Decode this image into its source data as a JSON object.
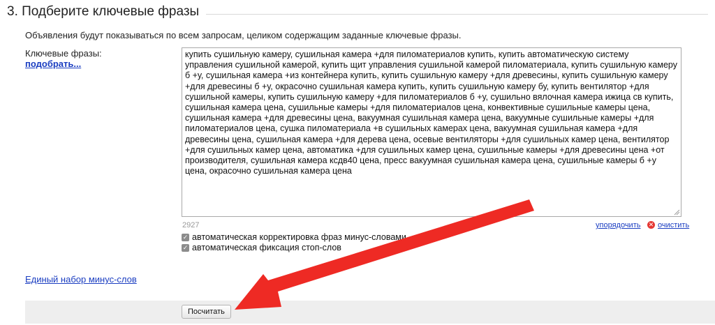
{
  "section": {
    "title": "3. Подберите ключевые фразы",
    "description": "Объявления будут показываться по всем запросам, целиком содержащим заданные ключевые фразы."
  },
  "keywords": {
    "label": "Ключевые фразы:",
    "pick_link": "подобрать...",
    "text": "купить сушильную камеру, сушильная камера +для пиломатериалов купить, купить автоматическую систему управления сушильной камерой, купить щит управления сушильной камерой пиломатериала, купить сушильную камеру б +у, сушильная камера +из контейнера купить, купить сушильную камеру +для древесины, купить сушильную камеру +для древесины б +у, окрасочно сушильная камера купить, купить сушильную камеру бу, купить вентилятор +для сушильной камеры, купить сушильную камеру +для пиломатериалов б +у, сушильно вялочная камера ижица св купить, сушильная камера цена, сушильные камеры +для пиломатериалов цена, конвективные сушильные камеры цена, сушильная камера +для древесины цена, вакуумная сушильная камера цена, вакуумные сушильные камеры +для пиломатериалов цена, сушка пиломатериала +в сушильных камерах цена, вакуумная сушильная камера +для древесины цена, сушильная камера +для дерева цена, осевые вентиляторы +для сушильных камер цена, вентилятор +для сушильных камер цена, автоматика +для сушильных камер цена, сушильные камеры +для древесины цена +от производителя, сушильная камера ксдв40 цена, пресс вакуумная сушильная камера цена, сушильные камеры б +у цена, окрасочно сушильная камера цена",
    "char_count": "2927",
    "sort_link": "упорядочить",
    "clear_link": "очистить",
    "auto_minus_label": "автоматическая корректировка фраз минус-словами",
    "auto_stop_label": "автоматическая фиксация стоп-слов"
  },
  "minus_words_link": "Единый набор минус-слов",
  "calculate_button": "Посчитать",
  "colors": {
    "link": "#1a3dc1",
    "arrow": "#ee2a24",
    "clear_icon": "#e53935"
  }
}
